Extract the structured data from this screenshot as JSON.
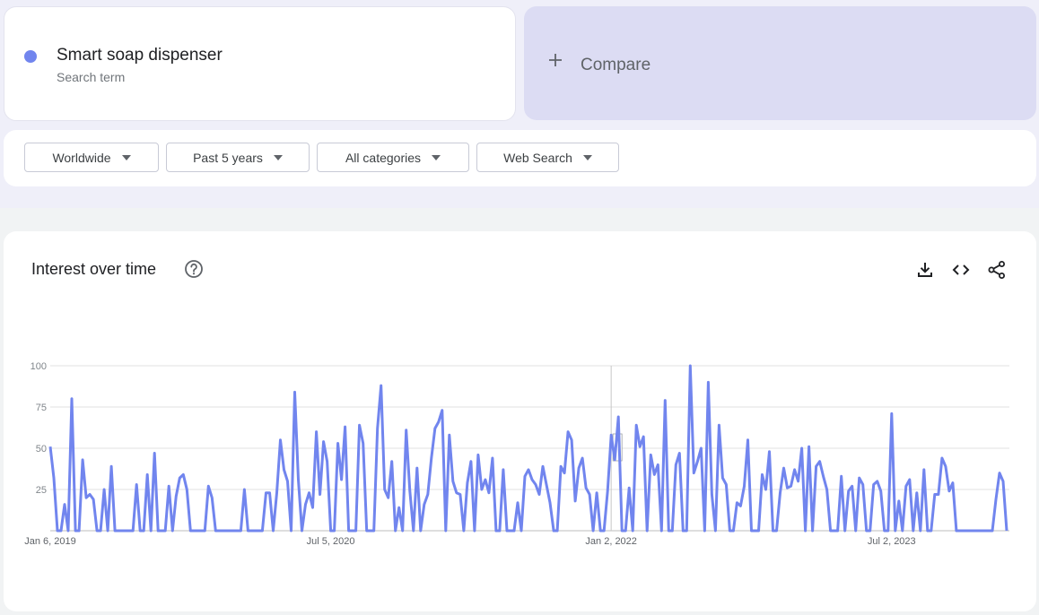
{
  "term": {
    "name": "Smart soap dispenser",
    "type": "Search term",
    "color": "#7185ee"
  },
  "compare": {
    "label": "Compare"
  },
  "filters": [
    {
      "label": "Worldwide"
    },
    {
      "label": "Past 5 years"
    },
    {
      "label": "All categories"
    },
    {
      "label": "Web Search"
    }
  ],
  "chart": {
    "title": "Interest over time",
    "icons": [
      "help-icon",
      "download-icon",
      "embed-code-icon",
      "share-icon"
    ]
  },
  "chart_data": {
    "type": "line",
    "title": "",
    "xlabel": "",
    "ylabel": "",
    "ylim": [
      0,
      100
    ],
    "yticks": [
      25,
      50,
      75,
      100
    ],
    "grid": true,
    "x_tick_labels": [
      "Jan 6, 2019",
      "Jul 5, 2020",
      "Jan 2, 2022",
      "Jul 2, 2023"
    ],
    "x_tick_indices": [
      0,
      78,
      156,
      234
    ],
    "annotation_index": 156,
    "series": [
      {
        "color": "#7185ee",
        "values": [
          51,
          32,
          0,
          0,
          16,
          0,
          80,
          0,
          0,
          43,
          20,
          22,
          19,
          0,
          0,
          25,
          0,
          39,
          0,
          0,
          0,
          0,
          0,
          0,
          28,
          0,
          0,
          34,
          0,
          47,
          0,
          0,
          0,
          27,
          0,
          21,
          32,
          34,
          25,
          0,
          0,
          0,
          0,
          0,
          27,
          20,
          0,
          0,
          0,
          0,
          0,
          0,
          0,
          0,
          25,
          0,
          0,
          0,
          0,
          0,
          23,
          23,
          0,
          23,
          55,
          37,
          30,
          0,
          84,
          31,
          0,
          16,
          23,
          14,
          60,
          22,
          54,
          42,
          0,
          0,
          53,
          31,
          63,
          0,
          0,
          0,
          64,
          53,
          0,
          0,
          0,
          62,
          88,
          25,
          20,
          42,
          0,
          14,
          0,
          61,
          24,
          0,
          38,
          0,
          16,
          22,
          44,
          62,
          66,
          73,
          0,
          58,
          30,
          23,
          22,
          0,
          29,
          42,
          0,
          46,
          25,
          31,
          23,
          44,
          0,
          0,
          37,
          0,
          0,
          0,
          17,
          0,
          33,
          37,
          31,
          28,
          22,
          39,
          28,
          17,
          0,
          0,
          39,
          35,
          60,
          55,
          18,
          38,
          44,
          26,
          22,
          0,
          23,
          0,
          0,
          24,
          58,
          43,
          69,
          0,
          0,
          26,
          0,
          64,
          51,
          57,
          0,
          46,
          34,
          40,
          0,
          79,
          0,
          0,
          40,
          47,
          0,
          0,
          100,
          35,
          42,
          50,
          0,
          90,
          22,
          0,
          64,
          32,
          28,
          0,
          0,
          17,
          15,
          27,
          55,
          0,
          0,
          0,
          34,
          25,
          48,
          0,
          0,
          23,
          38,
          26,
          27,
          37,
          30,
          50,
          0,
          51,
          0,
          39,
          42,
          33,
          25,
          0,
          0,
          0,
          33,
          0,
          24,
          27,
          0,
          32,
          28,
          0,
          0,
          28,
          30,
          24,
          0,
          0,
          71,
          0,
          18,
          0,
          27,
          31,
          0,
          23,
          0,
          37,
          0,
          0,
          22,
          22,
          44,
          39,
          24,
          29,
          0,
          0,
          0,
          0,
          0,
          0,
          0,
          0,
          0,
          0,
          0,
          19,
          35,
          30,
          0
        ]
      }
    ]
  }
}
